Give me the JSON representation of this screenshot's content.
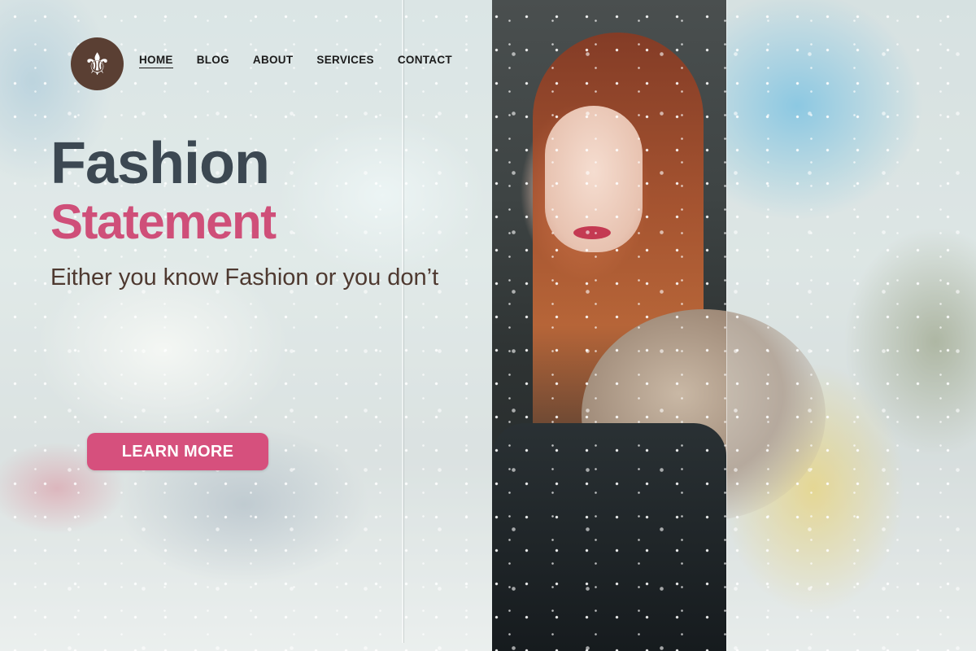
{
  "logo": {
    "icon": "fleur-de-lis-icon",
    "glyph": "⚜",
    "color": "#5a3f33"
  },
  "nav": {
    "items": [
      {
        "label": "HOME",
        "active": true
      },
      {
        "label": "BLOG",
        "active": false
      },
      {
        "label": "ABOUT",
        "active": false
      },
      {
        "label": "SERVICES",
        "active": false
      },
      {
        "label": "CONTACT",
        "active": false
      }
    ]
  },
  "hero": {
    "title_line1": "Fashion",
    "title_line2": "Statement",
    "tagline": "Either you know Fashion or you don’t",
    "cta_label": "LEARN MORE"
  },
  "colors": {
    "title_dark": "#3c4852",
    "accent_pink": "#cf4f79",
    "button_pink": "#d6507d",
    "tagline_brown": "#4e3930"
  }
}
